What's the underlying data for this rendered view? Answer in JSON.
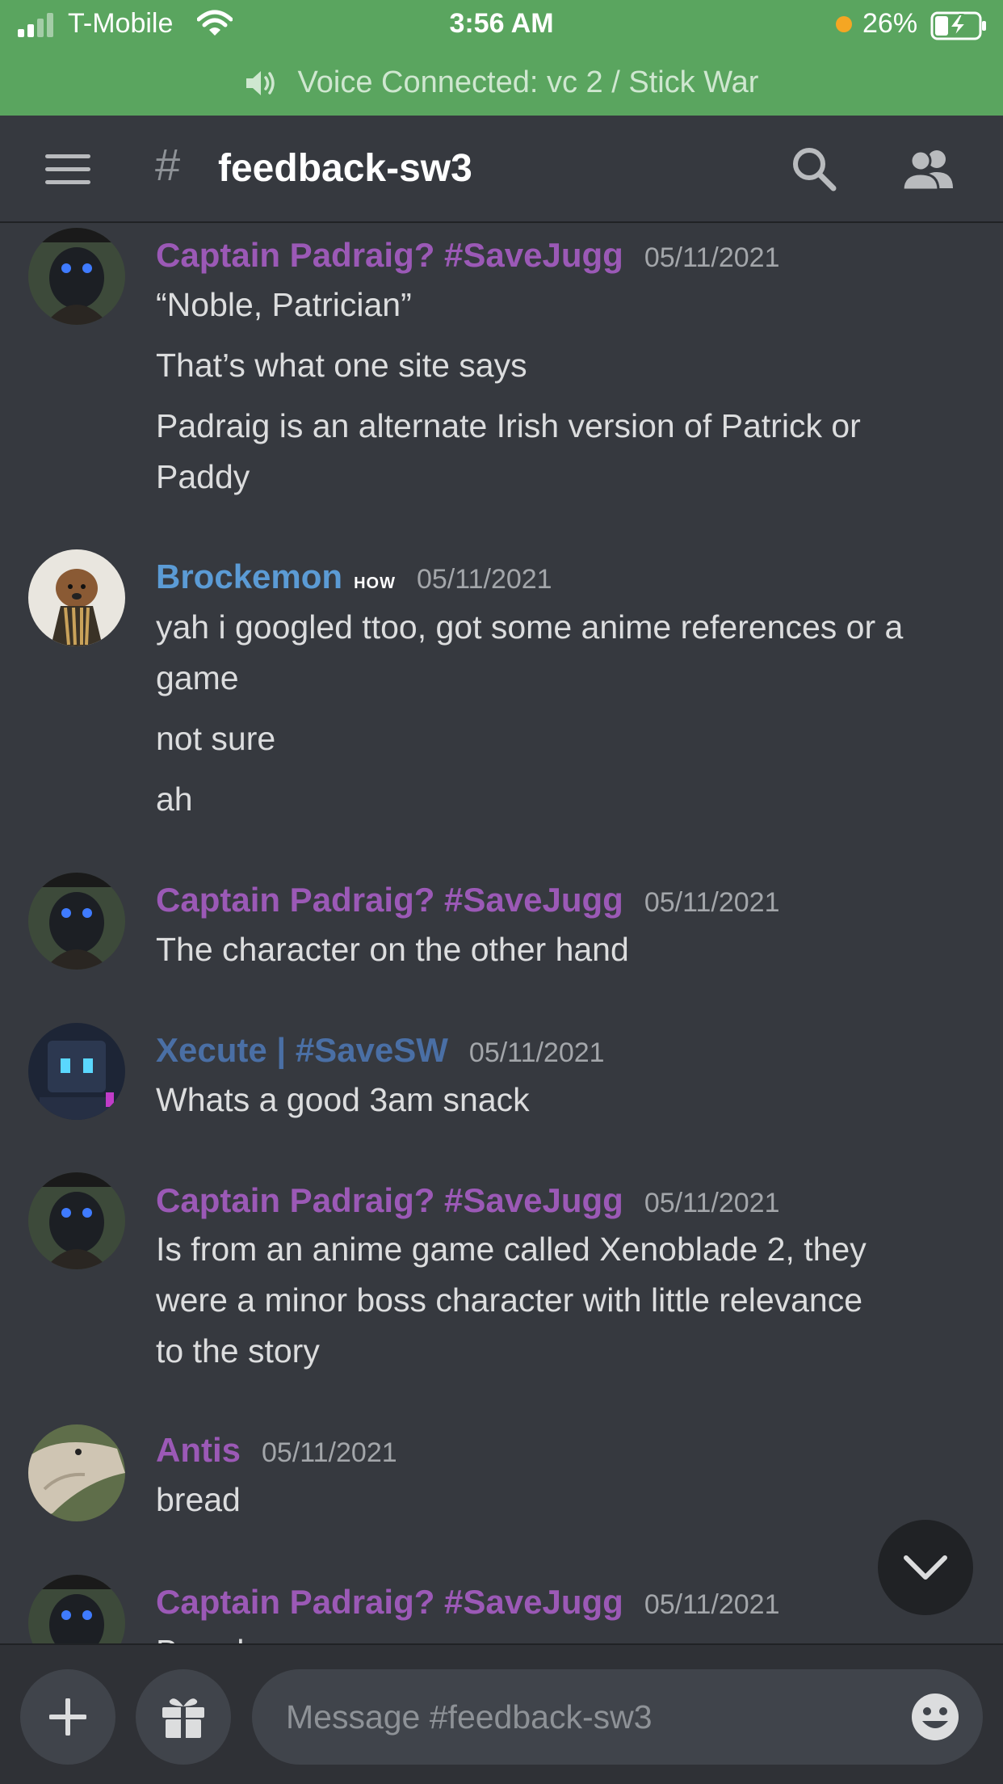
{
  "status_bar": {
    "carrier": "T-Mobile",
    "time": "3:56 AM",
    "battery": "26%"
  },
  "voice_banner": {
    "text": "Voice Connected: vc 2 / Stick War"
  },
  "header": {
    "hash": "#",
    "channel": "feedback-sw3"
  },
  "messages": [
    {
      "author": "Captain Padraig? #SaveJugg",
      "author_color": "#9b59b6",
      "timestamp": "05/11/2021",
      "avatar": "masked-character-avatar",
      "lines": [
        "“Noble, Patrician”",
        "That’s what one site says",
        "Padraig is an alternate Irish version of Patrick or",
        "Paddy"
      ]
    },
    {
      "author": "Brockemon",
      "author_color": "#5b9bd5",
      "tag": "HOW",
      "timestamp": "05/11/2021",
      "avatar": "dog-avatar",
      "lines": [
        "yah i googled ttoo, got some anime references or a",
        "game",
        "not sure",
        "ah"
      ]
    },
    {
      "author": "Captain Padraig? #SaveJugg",
      "author_color": "#9b59b6",
      "timestamp": "05/11/2021",
      "avatar": "masked-character-avatar",
      "lines": [
        "The character on the other hand"
      ]
    },
    {
      "author": "Xecute | #SaveSW",
      "author_color": "#4a6fa5",
      "timestamp": "05/11/2021",
      "avatar": "robot-avatar",
      "lines": [
        "Whats a good 3am snack"
      ]
    },
    {
      "author": "Captain Padraig? #SaveJugg",
      "author_color": "#9b59b6",
      "timestamp": "05/11/2021",
      "avatar": "masked-character-avatar",
      "lines": [
        "Is from an anime game called Xenoblade 2, they",
        "were a minor boss character with little relevance",
        "to the story"
      ]
    },
    {
      "author": "Antis",
      "author_color": "#9b59b6",
      "timestamp": "05/11/2021",
      "avatar": "lizard-avatar",
      "lines": [
        "bread"
      ]
    },
    {
      "author": "Captain Padraig? #SaveJugg",
      "author_color": "#9b59b6",
      "timestamp": "05/11/2021",
      "avatar": "masked-character-avatar",
      "lines": [
        "Bread"
      ]
    }
  ],
  "composer": {
    "placeholder": "Message #feedback-sw3"
  }
}
